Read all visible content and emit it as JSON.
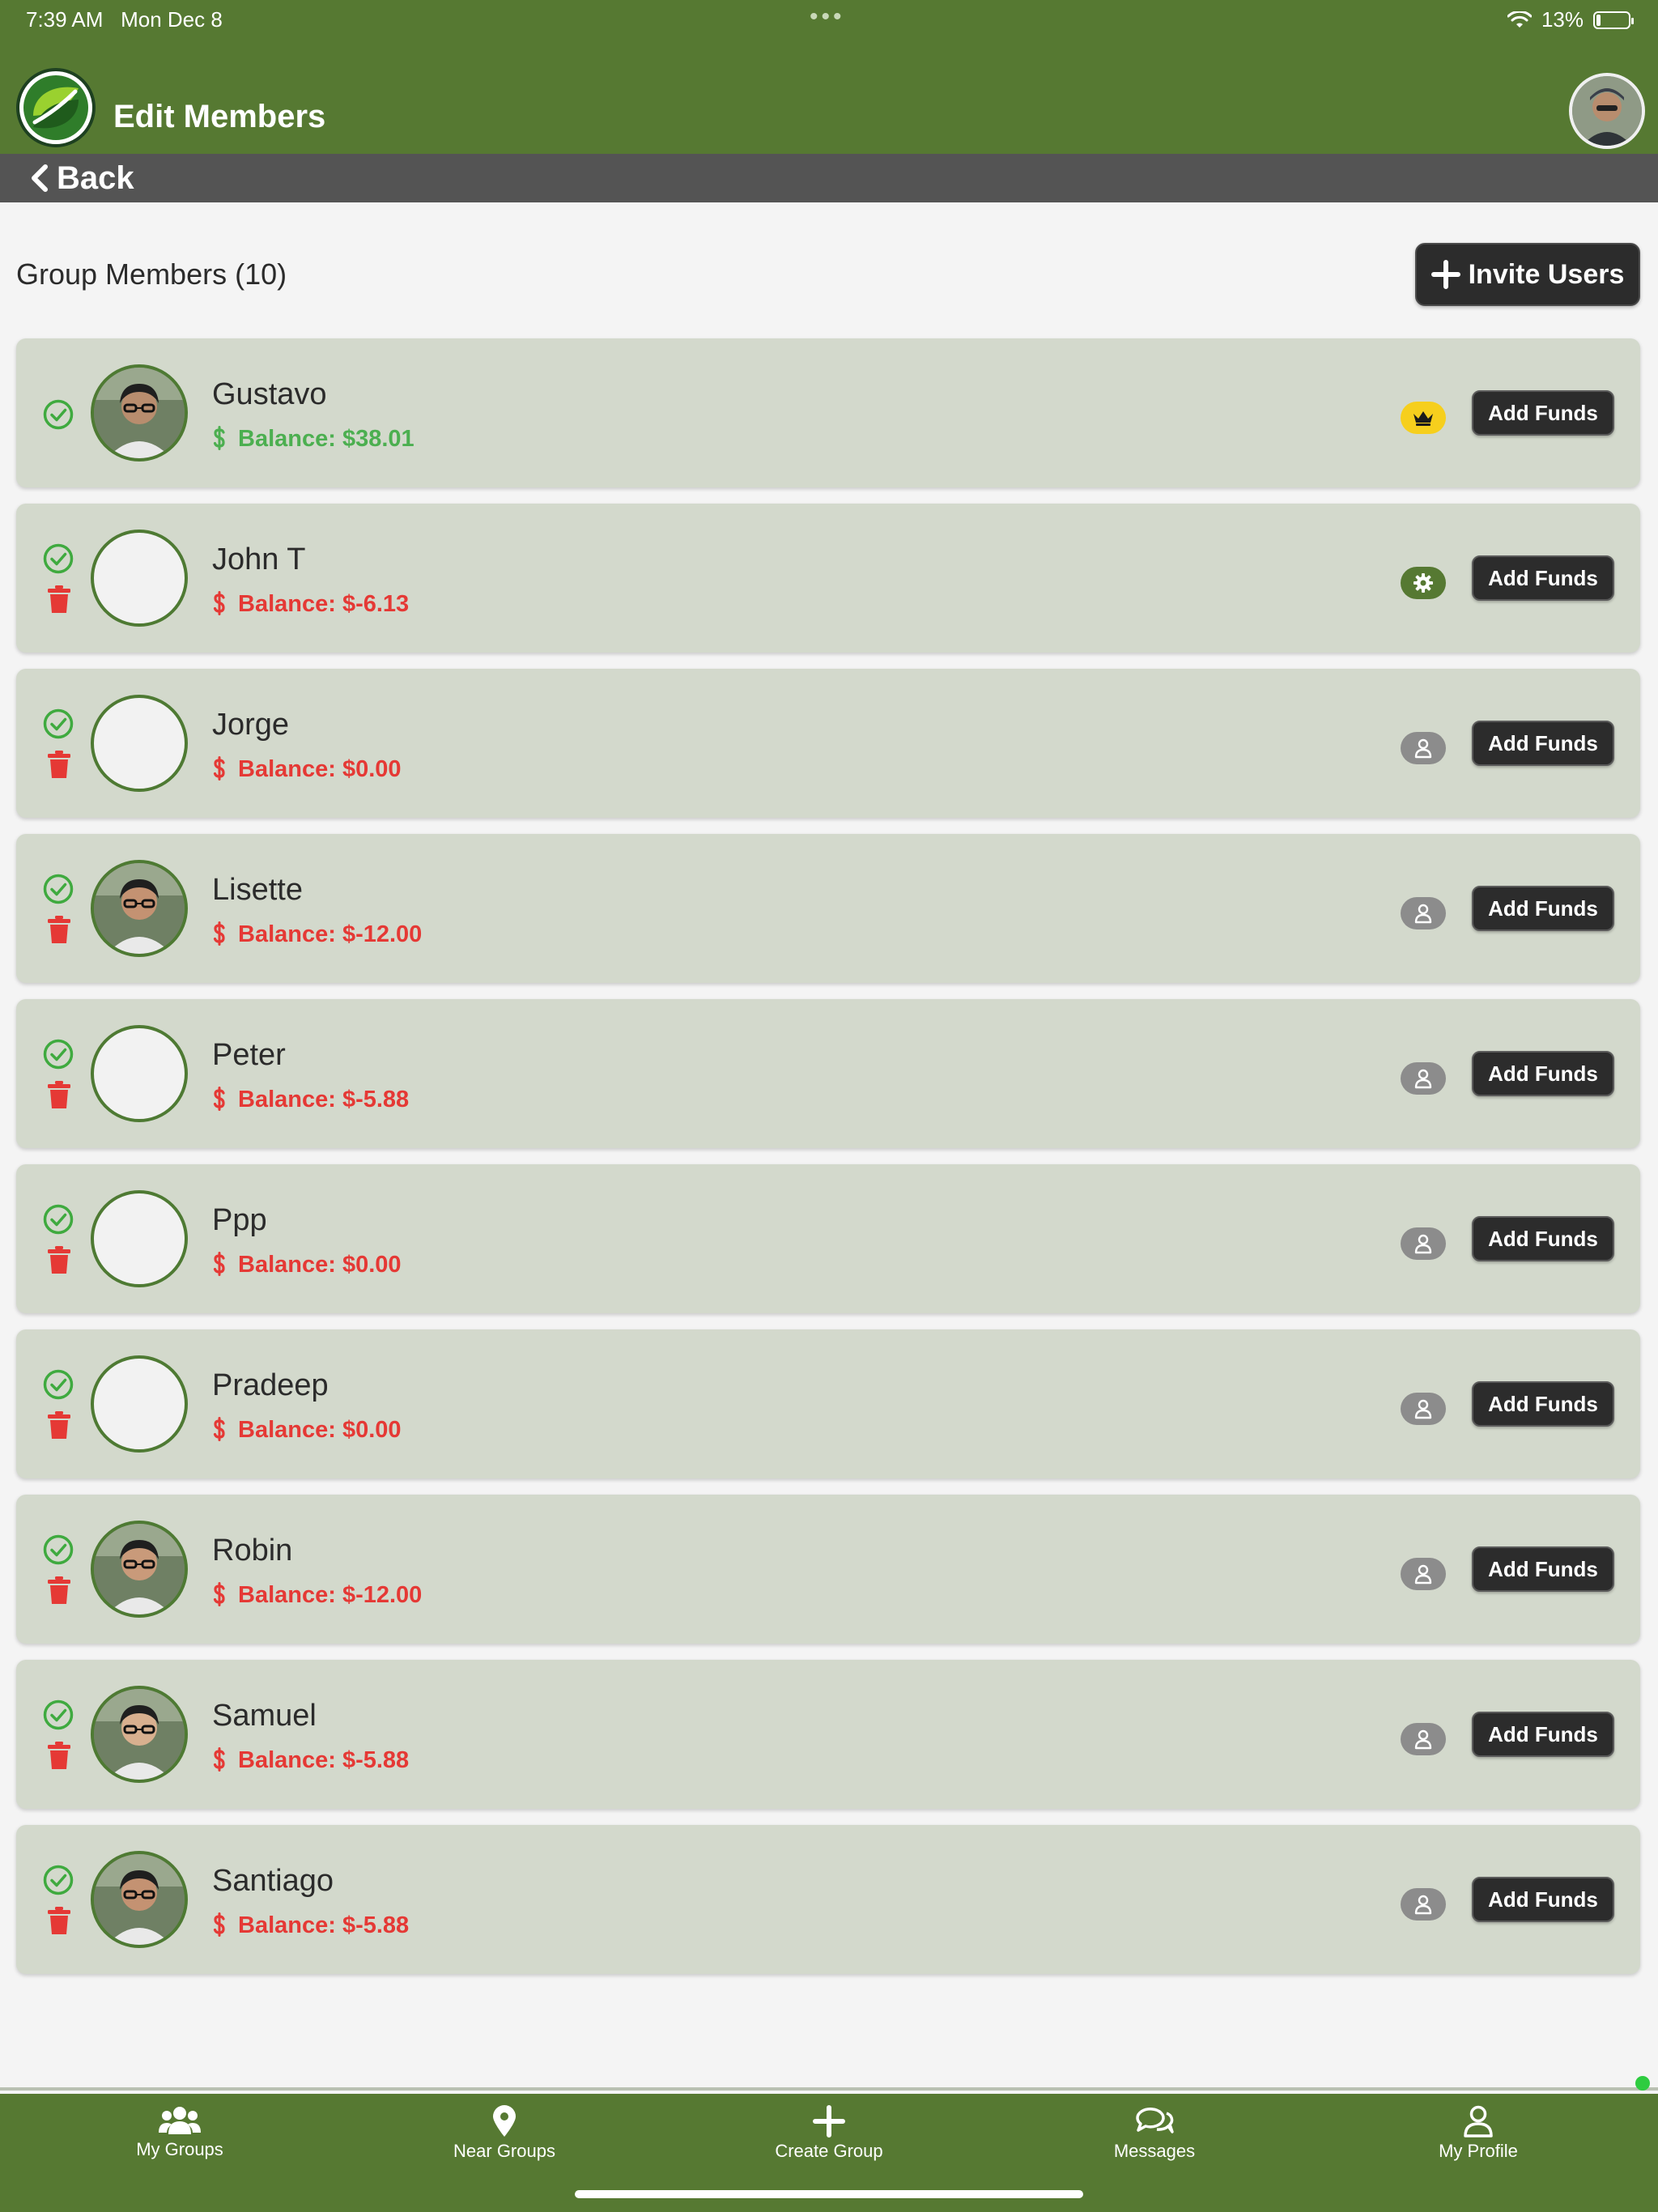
{
  "status_bar": {
    "time": "7:39 AM",
    "date": "Mon Dec 8",
    "battery_pct": "13%",
    "battery_level": 0.13
  },
  "header": {
    "title": "Edit Members",
    "logo_icon": "leaf-logo-icon",
    "profile_icon": "profile-avatar"
  },
  "back_bar": {
    "back_label": "Back"
  },
  "section": {
    "title": "Group Members (10)",
    "invite_label": "Invite Users"
  },
  "members": [
    {
      "name": "Gustavo",
      "balance": "Balance: $38.01",
      "balance_state": "positive",
      "role": "owner",
      "has_photo": true,
      "can_remove": false,
      "add_funds_label": "Add Funds"
    },
    {
      "name": "John T",
      "balance": "Balance: $-6.13",
      "balance_state": "negative",
      "role": "admin",
      "has_photo": false,
      "can_remove": true,
      "add_funds_label": "Add Funds"
    },
    {
      "name": "Jorge",
      "balance": "Balance: $0.00",
      "balance_state": "negative",
      "role": "member",
      "has_photo": false,
      "can_remove": true,
      "add_funds_label": "Add Funds"
    },
    {
      "name": "Lisette",
      "balance": "Balance: $-12.00",
      "balance_state": "negative",
      "role": "member",
      "has_photo": true,
      "can_remove": true,
      "add_funds_label": "Add Funds"
    },
    {
      "name": "Peter",
      "balance": "Balance: $-5.88",
      "balance_state": "negative",
      "role": "member",
      "has_photo": false,
      "can_remove": true,
      "add_funds_label": "Add Funds"
    },
    {
      "name": "Ppp",
      "balance": "Balance: $0.00",
      "balance_state": "negative",
      "role": "member",
      "has_photo": false,
      "can_remove": true,
      "add_funds_label": "Add Funds"
    },
    {
      "name": "Pradeep",
      "balance": "Balance: $0.00",
      "balance_state": "negative",
      "role": "member",
      "has_photo": false,
      "can_remove": true,
      "add_funds_label": "Add Funds"
    },
    {
      "name": "Robin",
      "balance": "Balance: $-12.00",
      "balance_state": "negative",
      "role": "member",
      "has_photo": true,
      "can_remove": true,
      "add_funds_label": "Add Funds"
    },
    {
      "name": "Samuel",
      "balance": "Balance: $-5.88",
      "balance_state": "negative",
      "role": "member",
      "has_photo": true,
      "can_remove": true,
      "add_funds_label": "Add Funds"
    },
    {
      "name": "Santiago",
      "balance": "Balance: $-5.88",
      "balance_state": "negative",
      "role": "member",
      "has_photo": true,
      "can_remove": true,
      "add_funds_label": "Add Funds"
    }
  ],
  "tab_bar": [
    {
      "label": "My Groups",
      "icon": "users-icon"
    },
    {
      "label": "Near Groups",
      "icon": "map-pin-icon"
    },
    {
      "label": "Create Group",
      "icon": "plus-icon"
    },
    {
      "label": "Messages",
      "icon": "chat-bubbles-icon"
    },
    {
      "label": "My Profile",
      "icon": "user-icon"
    }
  ],
  "colors": {
    "brand_green": "#567932",
    "card_bg": "#d3d9cc",
    "positive": "#4caf50",
    "negative": "#e53935",
    "owner_badge": "#f6cf1d",
    "member_badge": "#8c8c8c",
    "button_dark": "#2c2c2c"
  }
}
